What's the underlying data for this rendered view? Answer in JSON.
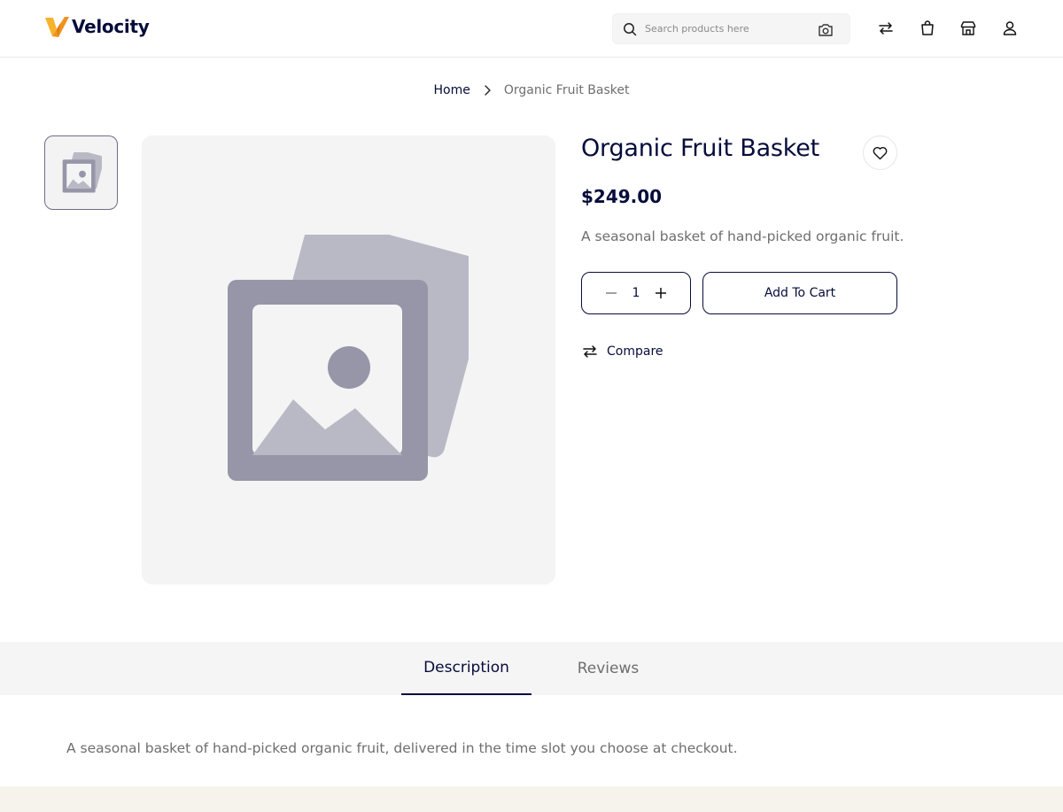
{
  "header": {
    "logo_text": "Velocity",
    "search_placeholder": "Search products here",
    "icons": [
      "search-icon",
      "camera-icon",
      "compare-icon",
      "cart-icon",
      "store-icon",
      "user-icon"
    ]
  },
  "breadcrumb": {
    "home": "Home",
    "current": "Organic Fruit Basket"
  },
  "product": {
    "title": "Organic Fruit Basket",
    "price": "$249.00",
    "short_description": "A seasonal basket of hand-picked organic fruit.",
    "quantity": "1",
    "add_to_cart_label": "Add To Cart",
    "compare_label": "Compare"
  },
  "tabs": [
    {
      "label": "Description",
      "active": true
    },
    {
      "label": "Reviews",
      "active": false
    }
  ],
  "description": {
    "text": "A seasonal basket of hand-picked organic fruit, delivered in the time slot you choose at checkout."
  },
  "colors": {
    "primary": "#060c3b",
    "muted_text": "#6e6e6e",
    "placeholder_dark": "#9696a8",
    "placeholder_light": "#b9b9c6",
    "footer_strip": "#f6f3ec"
  }
}
